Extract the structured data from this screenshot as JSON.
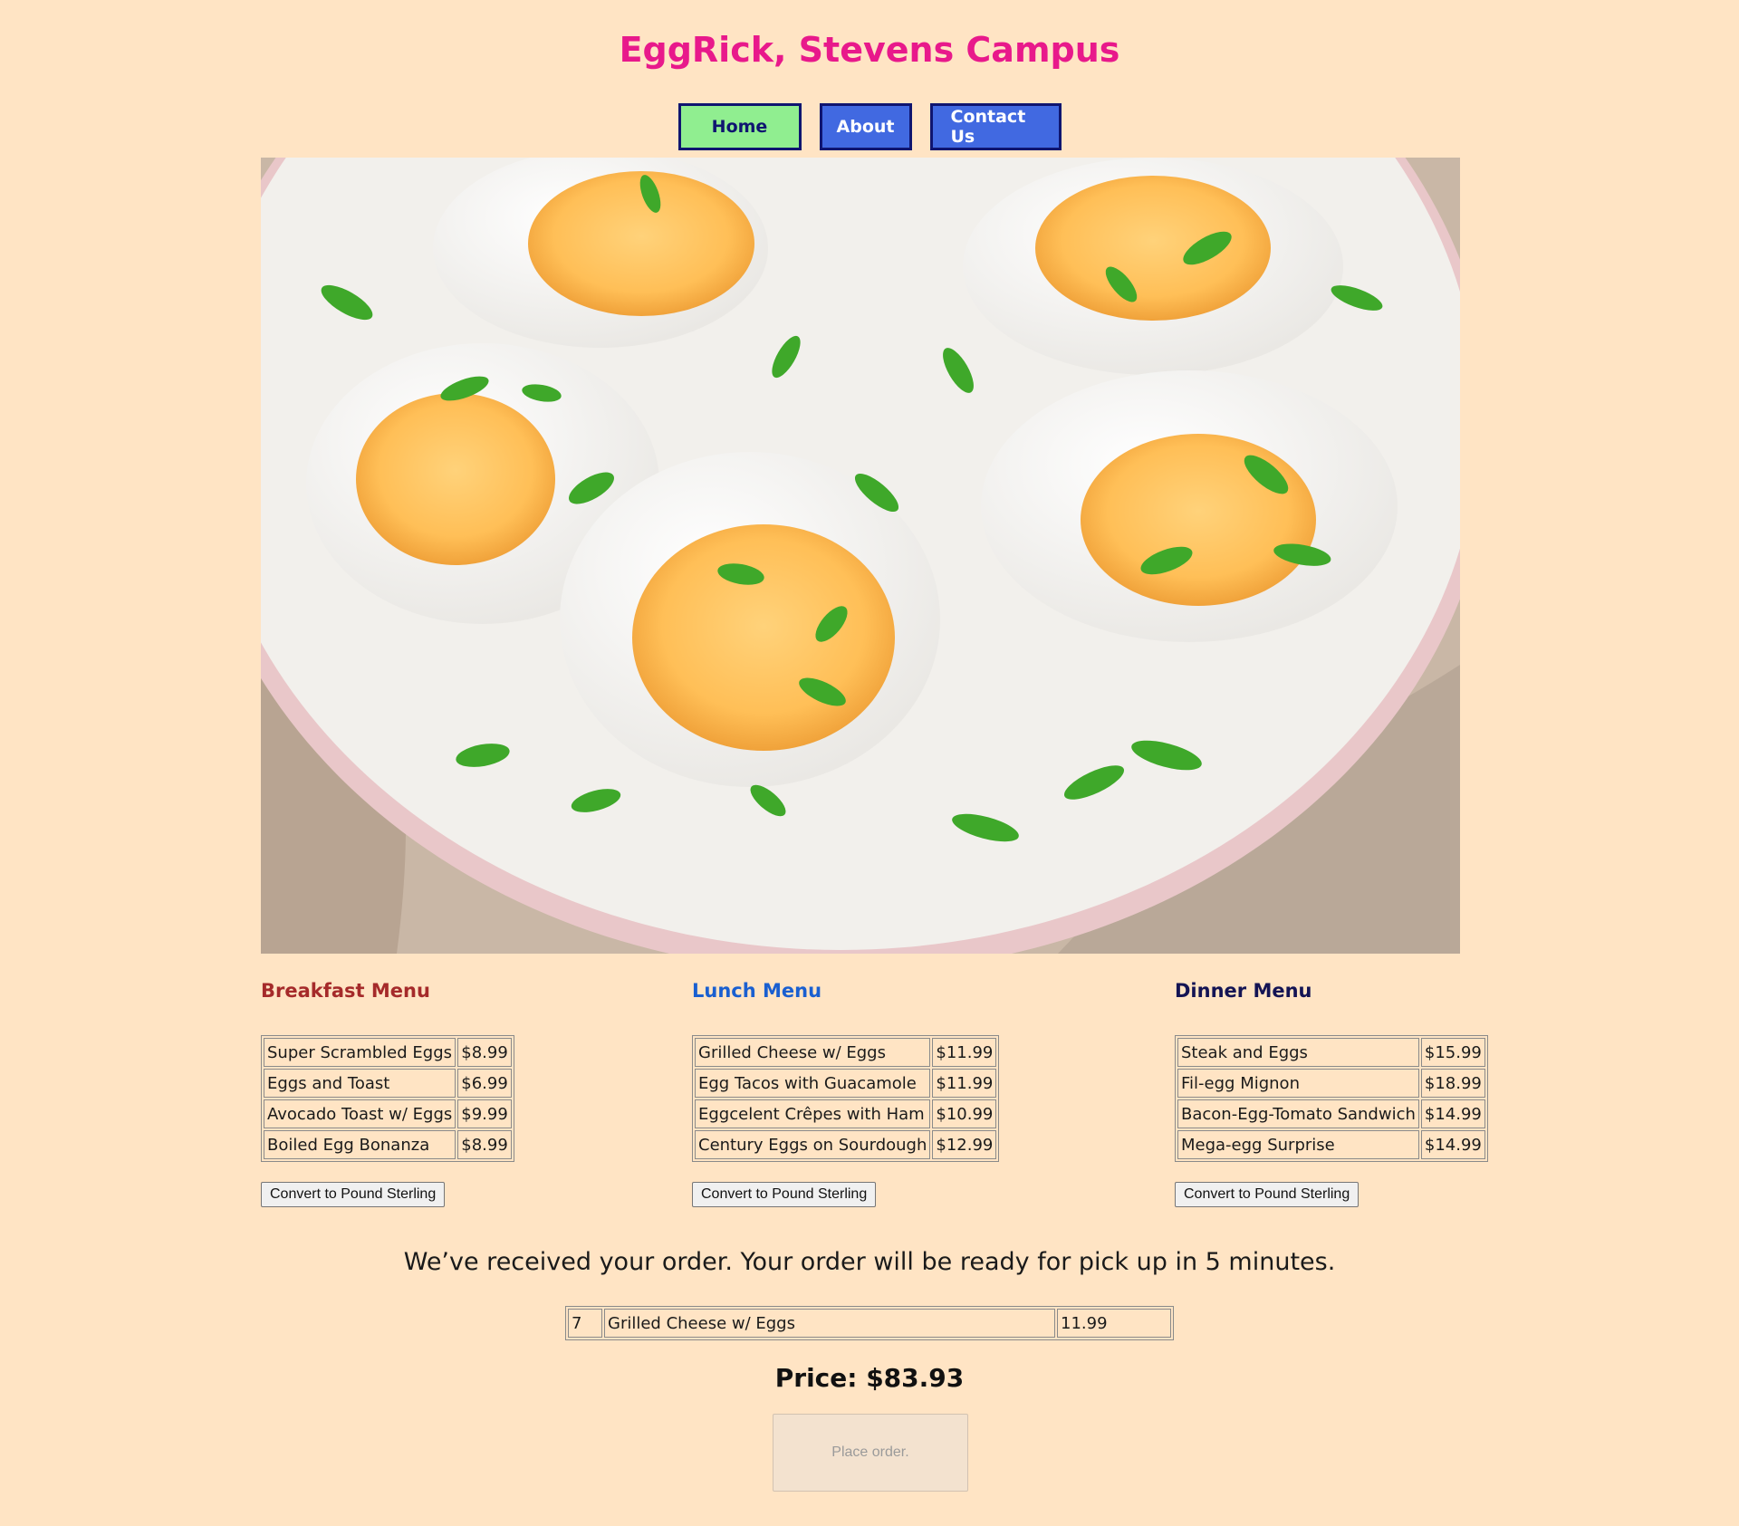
{
  "header": {
    "title": "EggRick, Stevens Campus"
  },
  "nav": {
    "home": "Home",
    "about": "About",
    "contact": "Contact Us"
  },
  "hero": {
    "image": "halved-boiled-eggs-with-green-onion-on-plate"
  },
  "menus": {
    "breakfast": {
      "title": "Breakfast Menu",
      "items": [
        {
          "name": "Super Scrambled Eggs",
          "price": "$8.99"
        },
        {
          "name": "Eggs and Toast",
          "price": "$6.99"
        },
        {
          "name": "Avocado Toast w/ Eggs",
          "price": "$9.99"
        },
        {
          "name": "Boiled Egg Bonanza",
          "price": "$8.99"
        }
      ],
      "convert_label": "Convert to Pound Sterling"
    },
    "lunch": {
      "title": "Lunch Menu",
      "items": [
        {
          "name": "Grilled Cheese w/ Eggs",
          "price": "$11.99"
        },
        {
          "name": "Egg Tacos with Guacamole",
          "price": "$11.99"
        },
        {
          "name": "Eggcelent Crêpes with Ham",
          "price": "$10.99"
        },
        {
          "name": "Century Eggs on Sourdough",
          "price": "$12.99"
        }
      ],
      "convert_label": "Convert to Pound Sterling"
    },
    "dinner": {
      "title": "Dinner Menu",
      "items": [
        {
          "name": "Steak and Eggs",
          "price": "$15.99"
        },
        {
          "name": "Fil-egg Mignon",
          "price": "$18.99"
        },
        {
          "name": "Bacon-Egg-Tomato Sandwich",
          "price": "$14.99"
        },
        {
          "name": "Mega-egg Surprise",
          "price": "$14.99"
        }
      ],
      "convert_label": "Convert to Pound Sterling"
    }
  },
  "order": {
    "confirmation": "We’ve received your order. Your order will be ready for pick up in 5 minutes.",
    "rows": [
      {
        "qty": "7",
        "item": "Grilled Cheese w/ Eggs",
        "price": "11.99"
      }
    ],
    "price_label": "Price: $83.93",
    "place_label": "Place order."
  },
  "colors": {
    "background": "#ffe4c4",
    "title": "#e8198b",
    "nav_home_bg": "#90ee90",
    "nav_bg": "#4169e1",
    "nav_border": "#0f1570",
    "breakfast_title": "#a52a2a",
    "lunch_title": "#1a5fd0",
    "dinner_title": "#141454"
  }
}
